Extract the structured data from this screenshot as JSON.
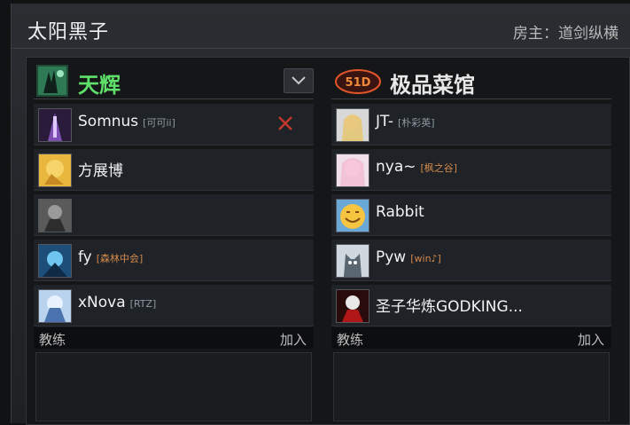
{
  "lobby": {
    "title": "太阳黑子",
    "host": "房主：道剑纵横"
  },
  "radiant": {
    "name": "天辉",
    "players": [
      {
        "name": "Somnus",
        "tag": "[可可ii]",
        "tag_color": "blue"
      },
      {
        "name": "方展博",
        "tag": "",
        "tag_color": "blue"
      },
      {
        "name": "",
        "tag": "",
        "tag_color": "blue"
      },
      {
        "name": "fy",
        "tag": "[森林中会]",
        "tag_color": "orange"
      },
      {
        "name": "xNova",
        "tag": "[RTZ]",
        "tag_color": "blue"
      }
    ],
    "coach_label": "教练",
    "join_label": "加入"
  },
  "dire": {
    "name": "极品菜馆",
    "logo_text": "51D",
    "players": [
      {
        "name": "JT-",
        "tag": "[朴彩英]",
        "tag_color": "blue"
      },
      {
        "name": "nya~",
        "tag": "[枫之谷]",
        "tag_color": "orange"
      },
      {
        "name": "Rabbit",
        "tag": "",
        "tag_color": "blue"
      },
      {
        "name": "Pyw",
        "tag": "[win♪]",
        "tag_color": "orange"
      },
      {
        "name": "圣子华炼GODKING...",
        "tag": "",
        "tag_color": "blue"
      }
    ],
    "coach_label": "教练",
    "join_label": "加入"
  },
  "colors": {
    "radiant_accent": "#5fe06a",
    "kick_red": "#c0392b",
    "tag_orange": "#d48a4c"
  },
  "icons": {
    "dropdown": "chevron-down-icon",
    "kick": "close-icon"
  }
}
